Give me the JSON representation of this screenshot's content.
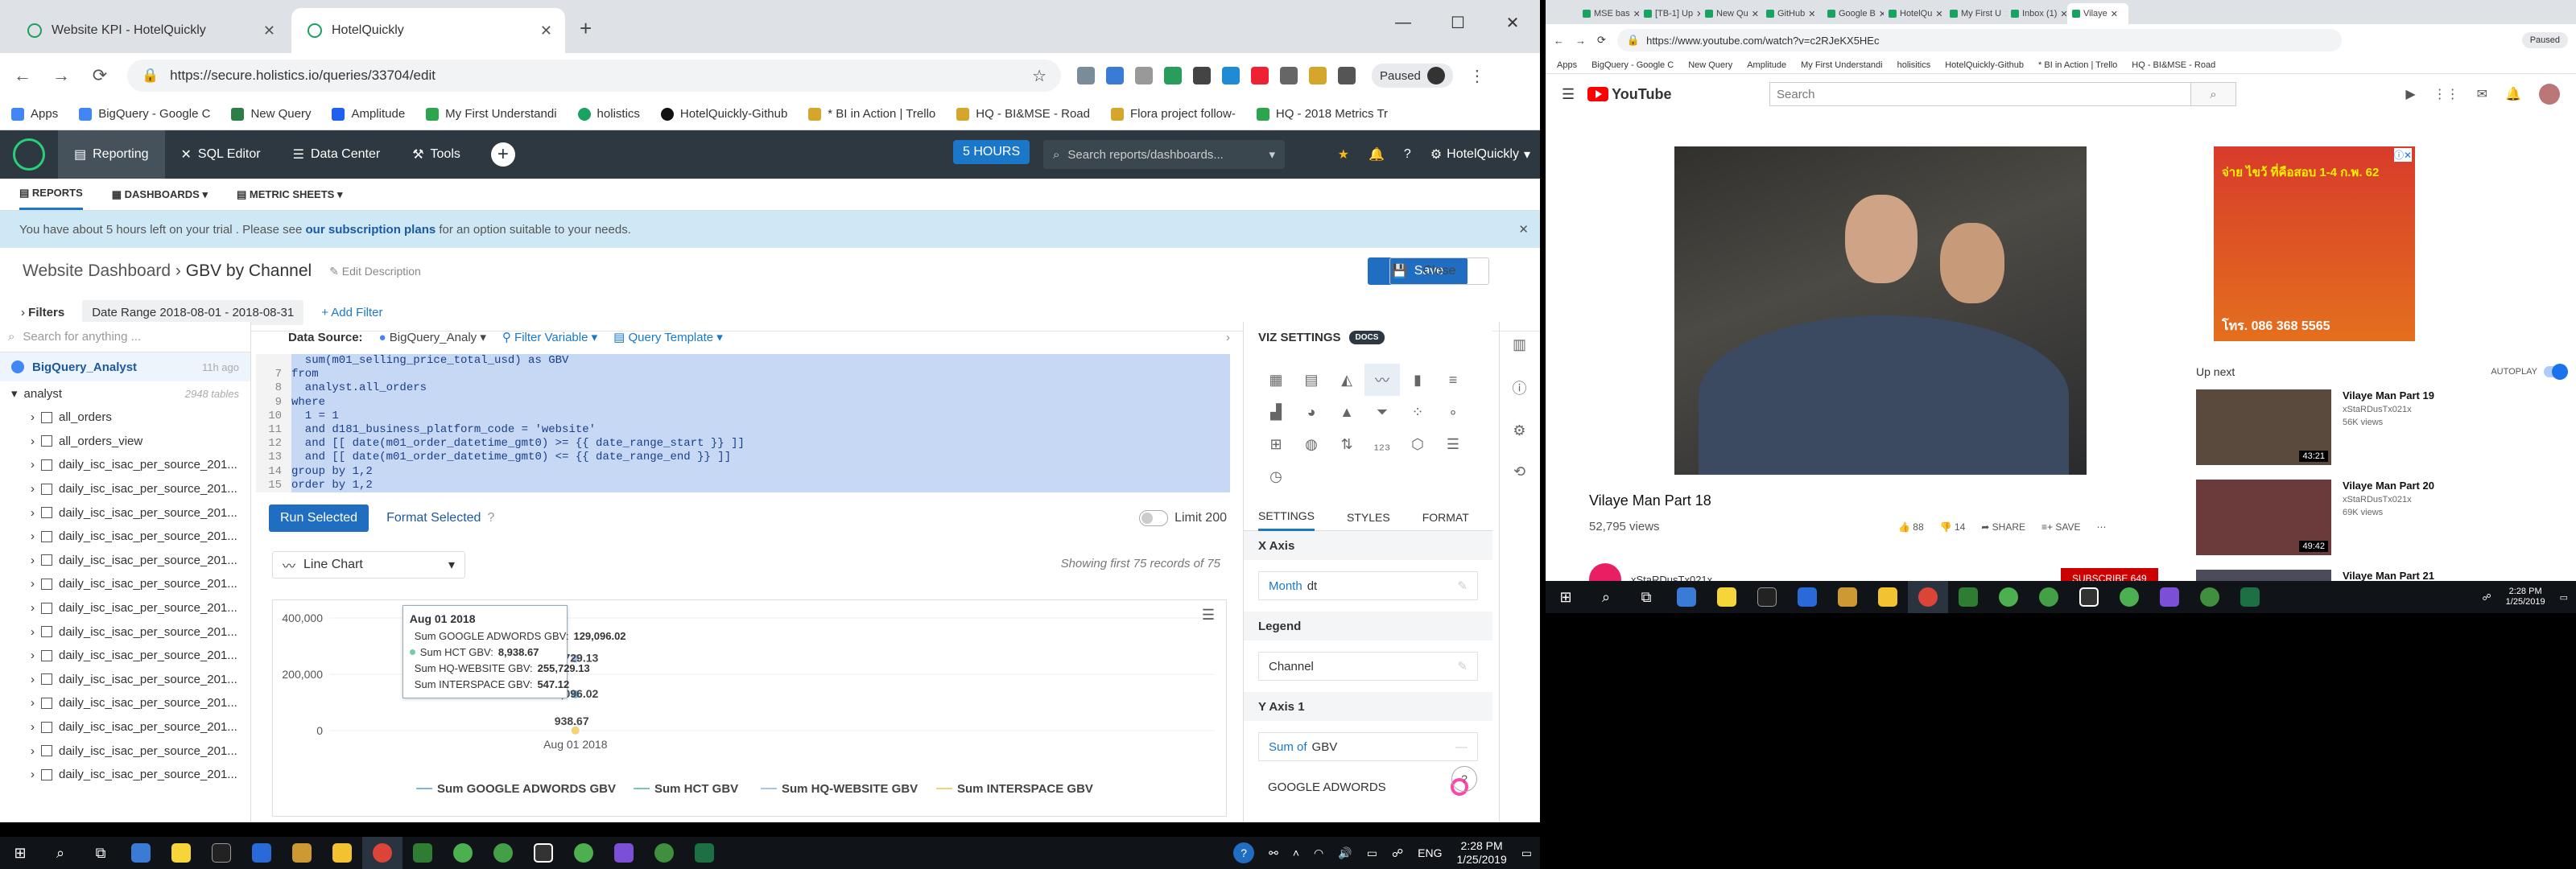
{
  "left_window": {
    "tabs": [
      {
        "title": "Website KPI - HotelQuickly",
        "active": false
      },
      {
        "title": "HotelQuickly",
        "active": true
      }
    ],
    "url": "https://secure.holistics.io/queries/33704/edit",
    "profile_status": "Paused",
    "bookmarks": [
      "Apps",
      "BigQuery - Google C",
      "New Query",
      "Amplitude",
      "My First Understandi",
      "holistics",
      "HotelQuickly-Github",
      "* BI in Action | Trello",
      "HQ - BI&MSE - Road",
      "Flora project follow-",
      "HQ - 2018 Metrics Tr"
    ]
  },
  "app": {
    "nav": [
      {
        "label": "Reporting",
        "active": true
      },
      {
        "label": "SQL Editor",
        "active": false
      },
      {
        "label": "Data Center",
        "active": false
      },
      {
        "label": "Tools",
        "active": false
      }
    ],
    "trial_badge": "5 HOURS",
    "search_placeholder": "Search reports/dashboards...",
    "company": "HotelQuickly",
    "subnav": [
      "REPORTS",
      "DASHBOARDS",
      "METRIC SHEETS"
    ],
    "trial_msg_pre": "You have about 5 hours left on your trial . Please see ",
    "trial_msg_link": "our subscription plans",
    "trial_msg_post": " for an option suitable to your needs.",
    "breadcrumb_parent": "Website Dashboard",
    "breadcrumb_current": "GBV by Channel",
    "edit_description": "Edit Description",
    "save_label": "Save",
    "close_label": "Close",
    "filters_label": "Filters",
    "date_range_label": "Date Range 2018-08-01 - 2018-08-31",
    "add_filter": "+ Add Filter"
  },
  "schema": {
    "search_placeholder": "Search for anything ...",
    "source_name": "BigQuery_Analyst",
    "source_time": "11h ago",
    "group_name": "analyst",
    "group_count": "2948 tables",
    "tables": [
      "all_orders",
      "all_orders_view",
      "daily_isc_isac_per_source_201...",
      "daily_isc_isac_per_source_201...",
      "daily_isc_isac_per_source_201...",
      "daily_isc_isac_per_source_201...",
      "daily_isc_isac_per_source_201...",
      "daily_isc_isac_per_source_201...",
      "daily_isc_isac_per_source_201...",
      "daily_isc_isac_per_source_201...",
      "daily_isc_isac_per_source_201...",
      "daily_isc_isac_per_source_201...",
      "daily_isc_isac_per_source_201...",
      "daily_isc_isac_per_source_201...",
      "daily_isc_isac_per_source_201...",
      "daily_isc_isac_per_source_201..."
    ]
  },
  "editor": {
    "data_source_label": "Data Source:",
    "data_source_value": "BigQuery_Analy",
    "filter_variable": "Filter Variable",
    "query_template": "Query Template",
    "code_lines": [
      {
        "no": "",
        "text": "  sum(m01_selling_price_total_usd) as GBV"
      },
      {
        "no": "7",
        "text": "from"
      },
      {
        "no": "8",
        "text": "  analyst.all_orders"
      },
      {
        "no": "9",
        "text": "where"
      },
      {
        "no": "10",
        "text": "  1 = 1"
      },
      {
        "no": "11",
        "text": "  and d181_business_platform_code = 'website'"
      },
      {
        "no": "12",
        "text": "  and [[ date(m01_order_datetime_gmt0) >= {{ date_range_start }} ]]"
      },
      {
        "no": "13",
        "text": "  and [[ date(m01_order_datetime_gmt0) <= {{ date_range_end }} ]]"
      },
      {
        "no": "14",
        "text": "group by 1,2"
      },
      {
        "no": "15",
        "text": "order by 1,2"
      }
    ],
    "run_selected": "Run Selected",
    "format_selected": "Format Selected",
    "limit_label": "Limit 200",
    "chart_type": "Line Chart",
    "showing_text": "Showing first 75 records of 75"
  },
  "tooltip": {
    "date": "Aug 01 2018",
    "rows": [
      {
        "label": "Sum GOOGLE ADWORDS GBV:",
        "value": "129,096.02",
        "color": "#7ab8e0"
      },
      {
        "label": "Sum HCT GBV:",
        "value": "8,938.67",
        "color": "#78c9a8"
      },
      {
        "label": "Sum HQ-WEBSITE GBV:",
        "value": "255,729.13",
        "color": "#a9c6e8"
      },
      {
        "label": "Sum INTERSPACE GBV:",
        "value": "547.12",
        "color": "#f3d27a"
      }
    ]
  },
  "chart_data": {
    "type": "line",
    "x": [
      "Aug 01 2018"
    ],
    "ylim": [
      0,
      400000
    ],
    "y_ticks": [
      "400,000",
      "200,000",
      "0"
    ],
    "x_tick": "Aug 01 2018",
    "partial_labels": [
      "5,729.13",
      "9,096.02",
      "938.67"
    ],
    "series": [
      {
        "name": "Sum GOOGLE ADWORDS GBV",
        "values": [
          129096.02
        ],
        "color": "#7ab8e0"
      },
      {
        "name": "Sum HCT GBV",
        "values": [
          8938.67
        ],
        "color": "#78c9a8"
      },
      {
        "name": "Sum HQ-WEBSITE GBV",
        "values": [
          255729.13
        ],
        "color": "#a9c6e8"
      },
      {
        "name": "Sum INTERSPACE GBV",
        "values": [
          547.12
        ],
        "color": "#f3d27a"
      }
    ],
    "legend_position": "bottom"
  },
  "viz": {
    "title": "VIZ SETTINGS",
    "docs": "DOCS",
    "tabs": [
      "SETTINGS",
      "STYLES",
      "FORMAT"
    ],
    "x_axis_label": "X Axis",
    "x_axis_field_prefix": "Month",
    "x_axis_field": "dt",
    "legend_label": "Legend",
    "legend_field": "Channel",
    "y_axis_label": "Y Axis 1",
    "y_axis_prefix": "Sum of",
    "y_axis_field": "GBV",
    "series_item": "GOOGLE ADWORDS"
  },
  "right_window": {
    "tabs": [
      "MSE bas",
      "[TB-1] Up",
      "New Qu",
      "GitHub",
      "Google B",
      "HotelQu",
      "My First U",
      "Inbox (1)",
      "Vilaye"
    ],
    "url": "https://www.youtube.com/watch?v=c2RJeKX5HEc",
    "profile_status": "Paused",
    "bookmarks": [
      "Apps",
      "BigQuery - Google C",
      "New Query",
      "Amplitude",
      "My First Understandi",
      "holisitics",
      "HotelQuickly-Github",
      "* BI in Action | Trello",
      "HQ - BI&MSE - Road"
    ],
    "yt_logo": "YouTube",
    "yt_search": "Search",
    "video_title": "Vilaye Man Part 18",
    "video_views": "52,795 views",
    "likes": "88",
    "dislikes": "14",
    "share": "SHARE",
    "save": "SAVE",
    "channel": "xStaRDusTx021x",
    "subscribe": "SUBSCRIBE 649",
    "ad_line1": "จ่าย ไขว้ ที่คือสอบ 1-4 ก.พ. 62",
    "ad_phone": "โทร. 086 368 5565",
    "up_next": "Up next",
    "autoplay": "AUTOPLAY",
    "up_next_items": [
      {
        "title": "Vilaye Man Part 19",
        "channel": "xStaRDusTx021x",
        "views": "56K views",
        "duration": "43:21"
      },
      {
        "title": "Vilaye Man Part 20",
        "channel": "xStaRDusTx021x",
        "views": "69K views",
        "duration": "49:42"
      },
      {
        "title": "Vilaye Man Part 21",
        "channel": "",
        "views": "",
        "duration": ""
      }
    ]
  },
  "taskbar": {
    "lang": "ENG",
    "time": "2:28 PM",
    "date": "1/25/2019",
    "time_right": "2:28 PM",
    "date_right": "1/25/2019"
  }
}
